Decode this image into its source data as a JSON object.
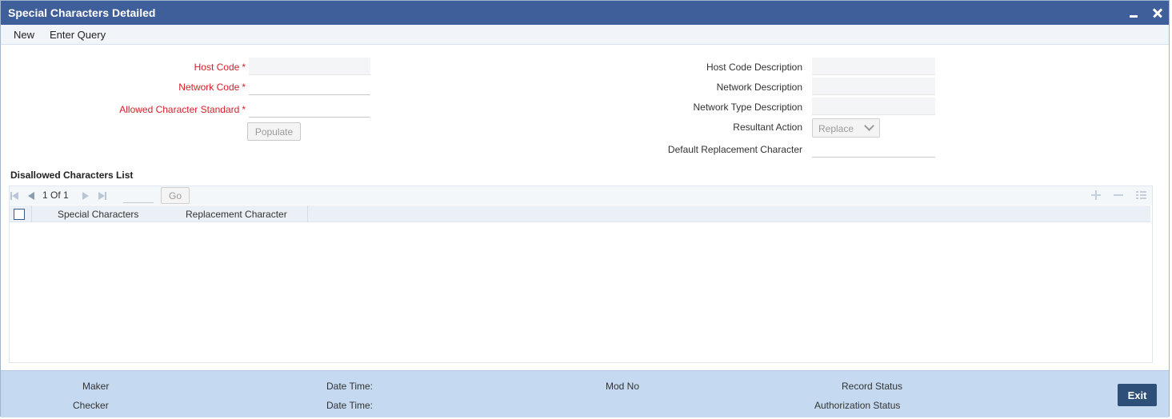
{
  "window": {
    "title": "Special Characters Detailed"
  },
  "menu": {
    "new": "New",
    "enter_query": "Enter Query"
  },
  "form": {
    "host_code": {
      "label": "Host Code",
      "required": "*",
      "value": ""
    },
    "network_code": {
      "label": "Network Code",
      "required": "*",
      "value": ""
    },
    "allowed_character_standard": {
      "label": "Allowed Character Standard",
      "required": "*",
      "value": ""
    },
    "populate_button": "Populate",
    "host_code_description": {
      "label": "Host Code Description",
      "value": ""
    },
    "network_description": {
      "label": "Network Description",
      "value": ""
    },
    "network_type_description": {
      "label": "Network Type Description",
      "value": ""
    },
    "resultant_action": {
      "label": "Resultant Action",
      "value": "Replace"
    },
    "default_replacement_character": {
      "label": "Default Replacement Character",
      "value": ""
    }
  },
  "grid": {
    "title": "Disallowed Characters List",
    "pagination": {
      "current": "1",
      "of_label": "Of",
      "total": "1",
      "go_label": "Go"
    },
    "columns": [
      "Special Characters",
      "Replacement Character"
    ],
    "rows": []
  },
  "footer": {
    "maker": "Maker",
    "checker": "Checker",
    "maker_date_time": "Date Time:",
    "checker_date_time": "Date Time:",
    "mod_no": "Mod No",
    "record_status": "Record Status",
    "authorization_status": "Authorization Status",
    "exit_button": "Exit"
  },
  "icons": {
    "minimize": "minimize-icon",
    "close": "close-icon",
    "first_page": "first-page-icon",
    "prev_page": "prev-page-icon",
    "next_page": "next-page-icon",
    "last_page": "last-page-icon",
    "add_row": "add-row-icon",
    "delete_row": "delete-row-icon",
    "single_view": "single-view-icon"
  },
  "colors": {
    "title_bar": "#3f5f9a",
    "required_label": "#d4202a",
    "footer_bg": "#c5daf0",
    "exit_button": "#2d4f78"
  }
}
